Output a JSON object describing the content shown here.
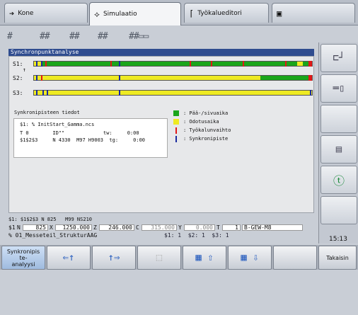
{
  "tabs": [
    {
      "label": "Kone",
      "icon": "arrow-right-icon"
    },
    {
      "label": "Simulaatio",
      "icon": "diamond-arrows-icon"
    },
    {
      "label": "Työkalueditori",
      "icon": "tool-icon"
    },
    {
      "label": "",
      "icon": "save-icon"
    }
  ],
  "panel": {
    "title": "Synchronpunktanalyse",
    "tracks": [
      {
        "label": "S1:"
      },
      {
        "label": "S2:"
      },
      {
        "label": "S3:"
      }
    ]
  },
  "info": {
    "title": "Synkronipisteen tiedot",
    "lines": [
      "$1: % InitStart_Gamma.ncs",
      "T 0        ID\"\"             tw:     0:00",
      "$1$2$3     N 4330  M97 H9003  tg:     0:00"
    ]
  },
  "legend": [
    {
      "label": ": Pää-/sivuaika",
      "color": "#1aa51a"
    },
    {
      "label": ": Odotusaika",
      "color": "#eeea22"
    },
    {
      "label": ": Työkalunvaihto",
      "color": "#e01818"
    },
    {
      "label": ": Synkronipiste",
      "color": "#1a2a9e"
    }
  ],
  "status": {
    "line1": "$1: $1$2$3 N 825   M99 NS210",
    "ch": "$1",
    "n_label": "N",
    "n_value": "825",
    "x_label": "X",
    "x_value": "1250.000",
    "z_label": "Z",
    "z_value": "246.000",
    "c_label": "C",
    "c_value": "315.000",
    "y_label": "Y",
    "y_value": "0.000",
    "t_label": "T",
    "t_value": "1",
    "tool": "B-GEW-M8",
    "file": "% 01_Messeteil_StrukturAAG",
    "channels": "$1: 1  $2: 1  $3: 1"
  },
  "clock": "15:13",
  "softkeys": [
    {
      "label": "Synkronipiste-analyysi",
      "lines": [
        "Synkronipis",
        "te-",
        "analyysi"
      ]
    },
    {
      "label": ""
    },
    {
      "label": ""
    },
    {
      "label": ""
    },
    {
      "label": ""
    },
    {
      "label": ""
    },
    {
      "label": ""
    },
    {
      "label": "Takaisin"
    }
  ]
}
